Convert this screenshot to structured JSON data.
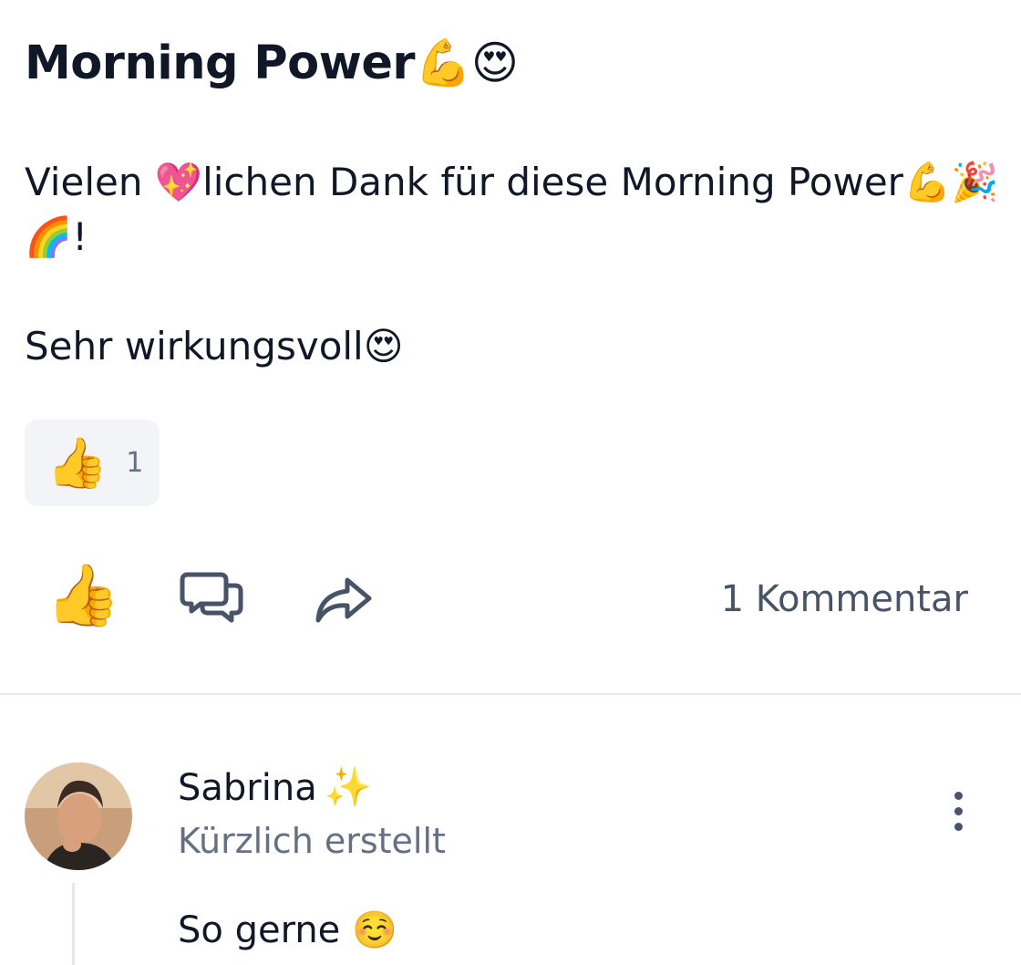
{
  "post": {
    "title": "Morning Power",
    "title_emojis": "💪😍",
    "body_line1": "Vielen 💖lichen Dank für diese Morning Power💪🎉🌈!",
    "body_line2": "Sehr wirkungsvoll😍"
  },
  "reaction": {
    "emoji": "👍",
    "count": "1"
  },
  "actions": {
    "like_icon": "thumbs-up-icon",
    "like_emoji": "👍",
    "comment_icon": "comment-bubbles-icon",
    "share_icon": "share-arrow-icon",
    "comment_count_label": "1 Kommentar"
  },
  "comment": {
    "author": "Sabrina",
    "author_emoji": "✨",
    "meta": "Kürzlich erstellt",
    "text": "So gerne ☺️",
    "more_icon": "more-vertical-icon"
  }
}
